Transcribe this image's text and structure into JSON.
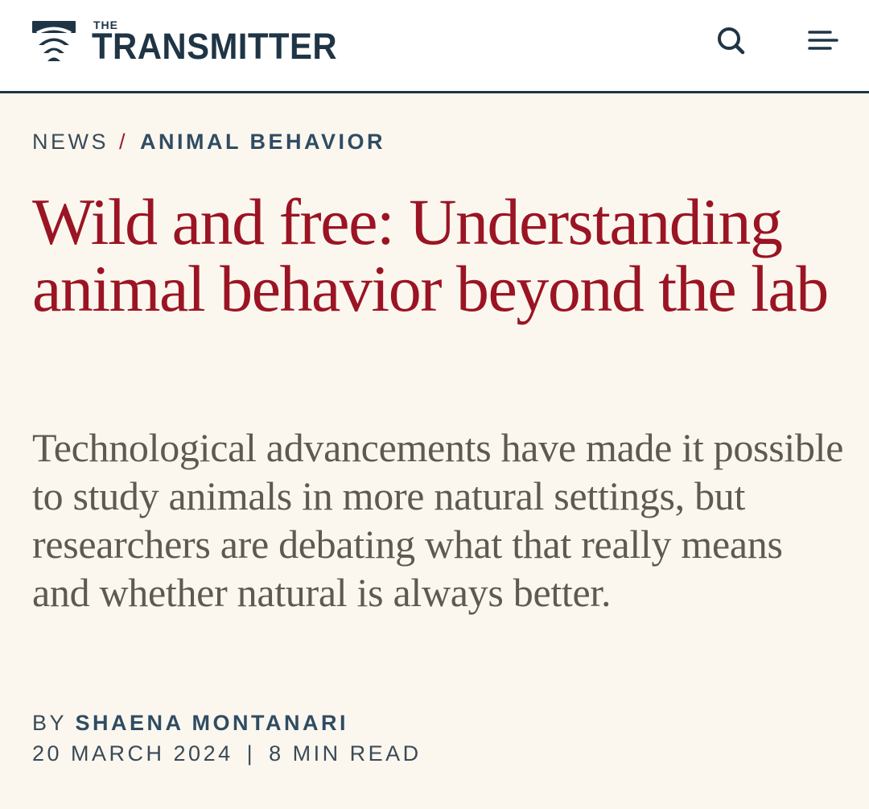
{
  "header": {
    "logo_the": "THE",
    "logo_name": "TRANSMITTER",
    "brand_color": "#1f3546",
    "icons": {
      "logo": "broadcast-signal-icon",
      "search": "search-icon",
      "menu": "hamburger-menu-icon"
    }
  },
  "breadcrumb": {
    "news": "NEWS",
    "separator": "/",
    "section": "ANIMAL BEHAVIOR"
  },
  "article": {
    "headline": "Wild and free: Understanding animal behavior beyond the lab",
    "dek": "Technological advancements have made it possible to study animals in more natural settings, but researchers are debating what that really means and whether natural is always better.",
    "byline_prefix": "BY",
    "author": "SHAENA MONTANARI",
    "date": "20 MARCH 2024",
    "meta_separator": "|",
    "read_time": "8 MIN READ"
  },
  "colors": {
    "headline": "#9b1424",
    "background": "#fbf7ee",
    "accent_link": "#2f4c63"
  }
}
